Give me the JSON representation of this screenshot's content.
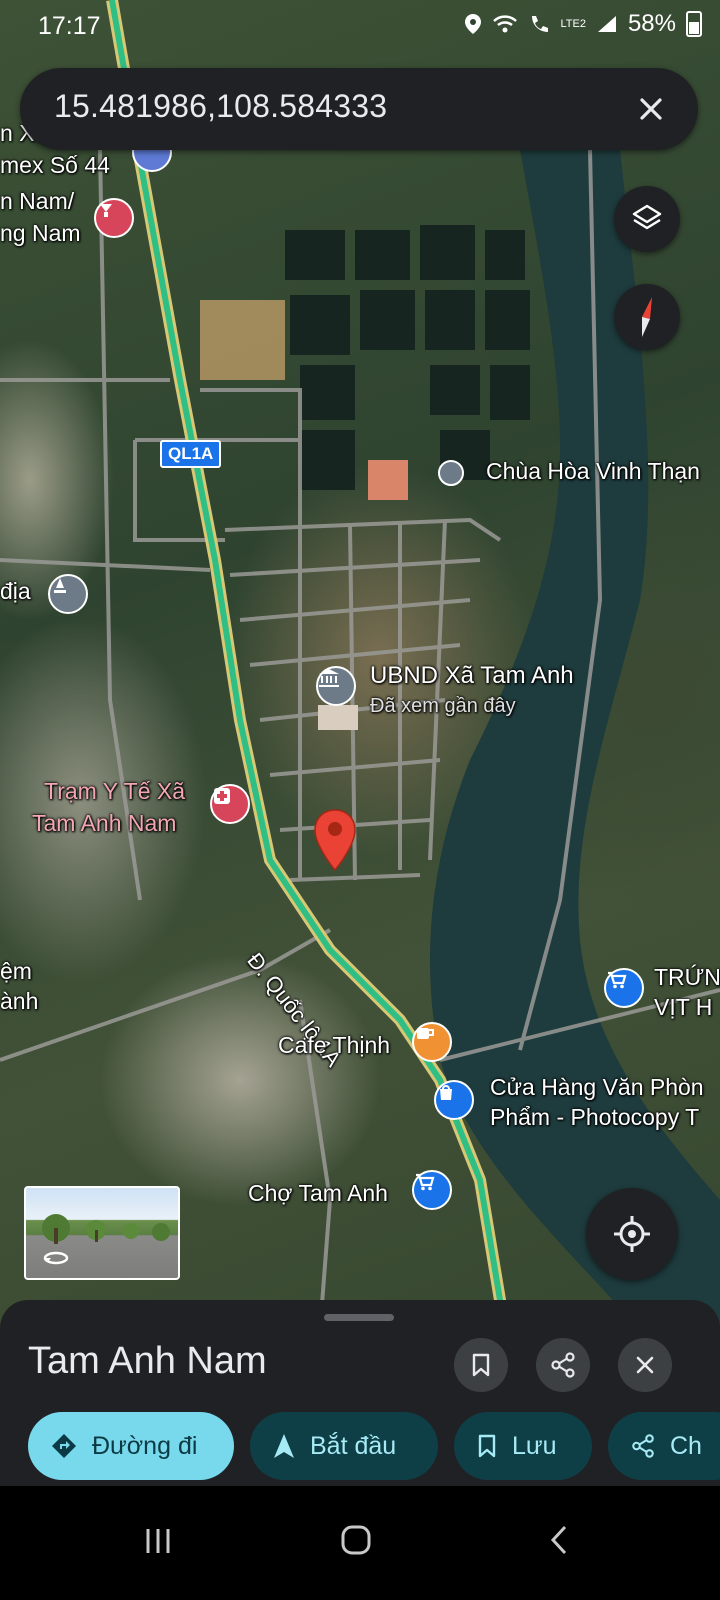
{
  "status_bar": {
    "time": "17:17",
    "battery": "58%",
    "network": "LTE2"
  },
  "search": {
    "coordinates": "15.481986,108.584333"
  },
  "map": {
    "road_shield": "QL1A",
    "labels": [
      {
        "id": "ubnd_title",
        "text": "UBND Xã Tam Anh"
      },
      {
        "id": "ubnd_sub",
        "text": "Đã xem gần đây"
      },
      {
        "id": "chua",
        "text": "Chùa Hòa Vinh Thạn"
      },
      {
        "id": "tram_1",
        "text": "Trạm Y Tế Xã"
      },
      {
        "id": "tram_2",
        "text": "Tam Anh Nam"
      },
      {
        "id": "road",
        "text": "Đ. Quốc lộ 1A"
      },
      {
        "id": "cafe",
        "text": "Cafe Thịnh"
      },
      {
        "id": "cuahang_1",
        "text": "Cửa Hàng Văn Phòn"
      },
      {
        "id": "cuahang_2",
        "text": "Phẩm - Photocopy T"
      },
      {
        "id": "cho",
        "text": "Chợ Tam Anh"
      },
      {
        "id": "trung_1",
        "text": "TRỨN"
      },
      {
        "id": "trung_2",
        "text": "VỊT H"
      },
      {
        "id": "left_1",
        "text": "n Xa"
      },
      {
        "id": "left_2",
        "text": "mex Số 44"
      },
      {
        "id": "left_3",
        "text": "n Nam/"
      },
      {
        "id": "left_4",
        "text": "ng Nam"
      },
      {
        "id": "left_5",
        "text": "địa"
      },
      {
        "id": "left_6",
        "text": "ệm"
      },
      {
        "id": "left_7",
        "text": "ành"
      }
    ]
  },
  "sheet": {
    "title": "Tam Anh Nam",
    "chips": {
      "directions": "Đường đi",
      "start": "Bắt đầu",
      "save": "Lưu",
      "share": "Ch"
    }
  },
  "colors": {
    "accent": "#78d9ec",
    "pin": "#ea4335",
    "route": "#34c48e",
    "sheet_bg": "#202124"
  }
}
